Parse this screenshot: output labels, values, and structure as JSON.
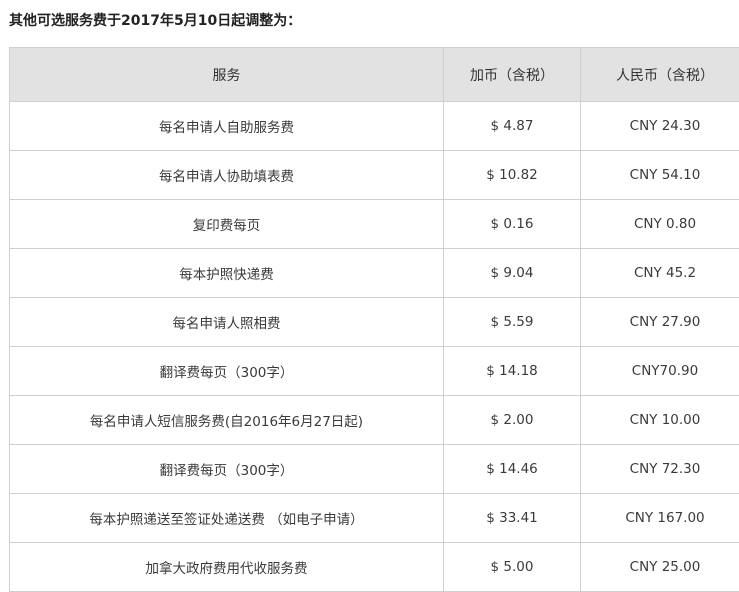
{
  "title": "其他可选服务费于2017年5月10日起调整为：",
  "table": {
    "headers": [
      "服务",
      "加币（含税）",
      "人民币（含税）"
    ],
    "rows": [
      [
        "每名申请人自助服务费",
        "$ 4.87",
        "CNY 24.30"
      ],
      [
        "每名申请人协助填表费",
        "$ 10.82",
        "CNY 54.10"
      ],
      [
        "复印费每页",
        "$ 0.16",
        "CNY 0.80"
      ],
      [
        "每本护照快递费",
        "$ 9.04",
        "CNY 45.2"
      ],
      [
        "每名申请人照相费",
        "$ 5.59",
        "CNY 27.90"
      ],
      [
        "翻译费每页（300字）",
        "$ 14.18",
        "CNY70.90"
      ],
      [
        "每名申请人短信服务费(自2016年6月27日起)",
        "$ 2.00",
        "CNY 10.00"
      ],
      [
        "翻译费每页（300字）",
        "$ 14.46",
        "CNY 72.30"
      ],
      [
        "每本护照递送至签证处递送费 （如电子申请）",
        "$ 33.41",
        "CNY 167.00"
      ],
      [
        "加拿大政府费用代收服务费",
        "$ 5.00",
        "CNY 25.00"
      ]
    ]
  }
}
